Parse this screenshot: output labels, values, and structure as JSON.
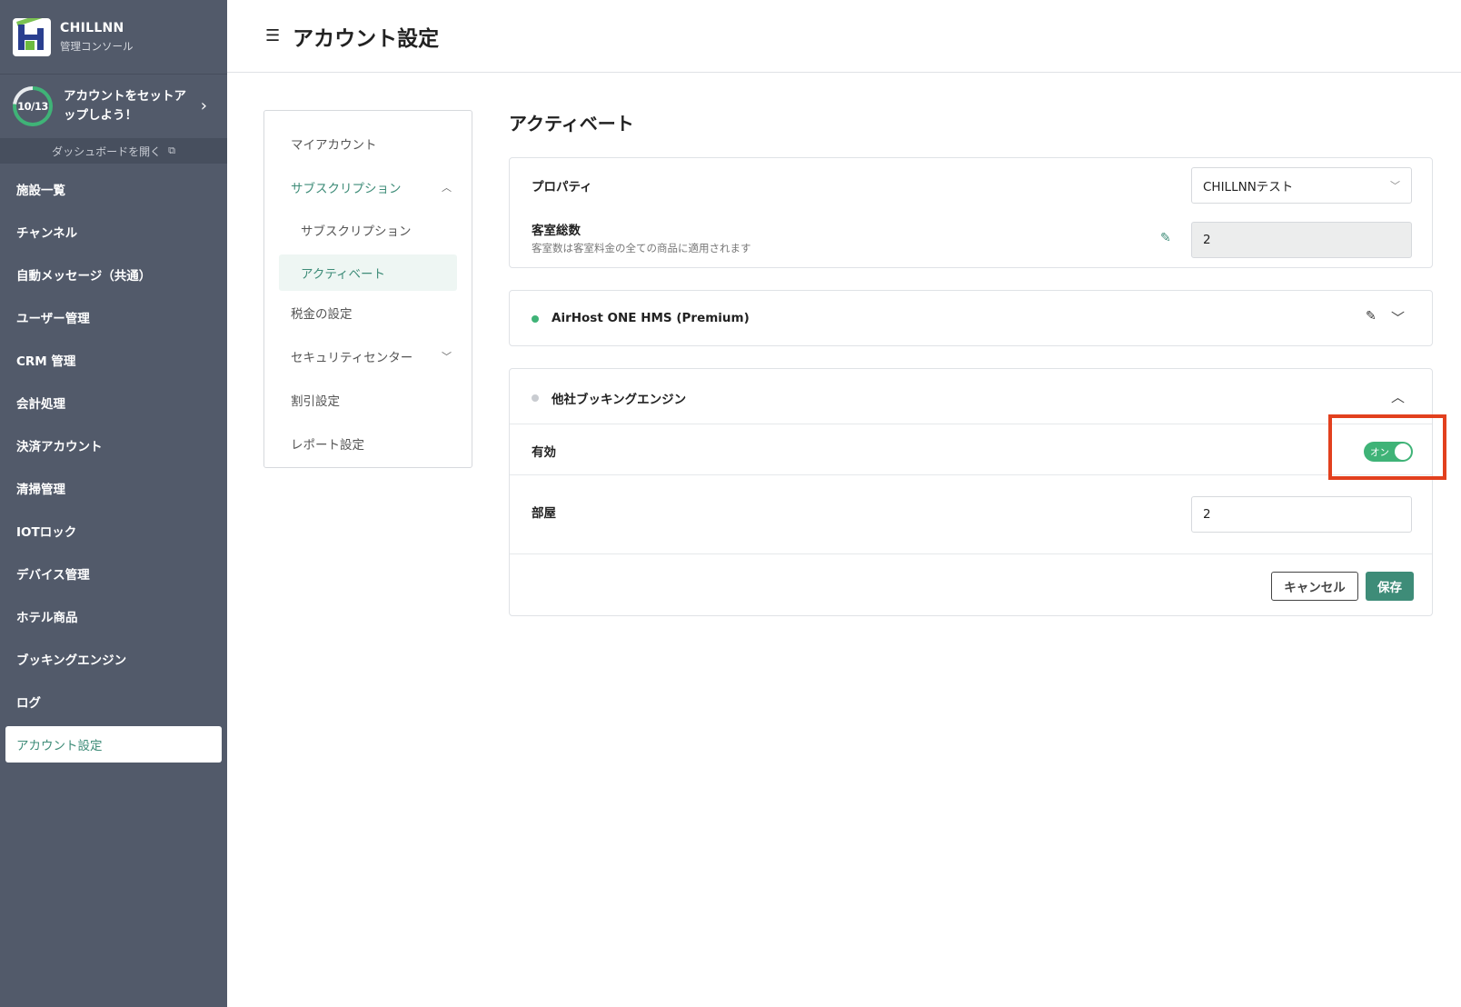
{
  "app": {
    "name": "CHILLNN",
    "subtitle": "管理コンソール"
  },
  "setup": {
    "progress": "10/13",
    "progress_fraction": 0.77,
    "text": "アカウントをセットアップしよう！",
    "dashboard_link": "ダッシュボードを開く"
  },
  "sidebar": {
    "items": [
      {
        "label": "施設一覧"
      },
      {
        "label": "チャンネル"
      },
      {
        "label": "自動メッセージ（共通）"
      },
      {
        "label": "ユーザー管理"
      },
      {
        "label": "CRM 管理"
      },
      {
        "label": "会計処理"
      },
      {
        "label": "決済アカウント"
      },
      {
        "label": "清掃管理"
      },
      {
        "label": "IOTロック"
      },
      {
        "label": "デバイス管理"
      },
      {
        "label": "ホテル商品"
      },
      {
        "label": "ブッキングエンジン"
      },
      {
        "label": "ログ"
      },
      {
        "label": "アカウント設定",
        "active": true
      }
    ]
  },
  "header": {
    "title": "アカウント設定"
  },
  "submenu": {
    "my_account": "マイアカウント",
    "subscription_parent": "サブスクリプション",
    "subscription_child": "サブスクリプション",
    "activate": "アクティベート",
    "tax": "税金の設定",
    "security": "セキュリティセンター",
    "discount": "割引設定",
    "report": "レポート設定"
  },
  "main": {
    "title": "アクティベート",
    "property_label": "プロパティ",
    "property_value": "CHILLNNテスト",
    "rooms_total_label": "客室総数",
    "rooms_total_desc": "客室数は客室料金の全ての商品に適用されます",
    "rooms_total_value": "2",
    "hms_title": "AirHost ONE HMS (Premium)",
    "engine_title": "他社ブッキングエンジン",
    "enabled_label": "有効",
    "toggle_text": "オン",
    "rooms_label": "部屋",
    "rooms_value": "2",
    "cancel": "キャンセル",
    "save": "保存"
  },
  "colors": {
    "accent": "#3e8c78",
    "sidebar": "#525a6a",
    "toggle_on": "#3fb377",
    "highlight": "#e2401e"
  },
  "icons": {
    "menu": "menu-collapse-icon",
    "external": "external-link-icon",
    "edit": "pencil-icon"
  }
}
